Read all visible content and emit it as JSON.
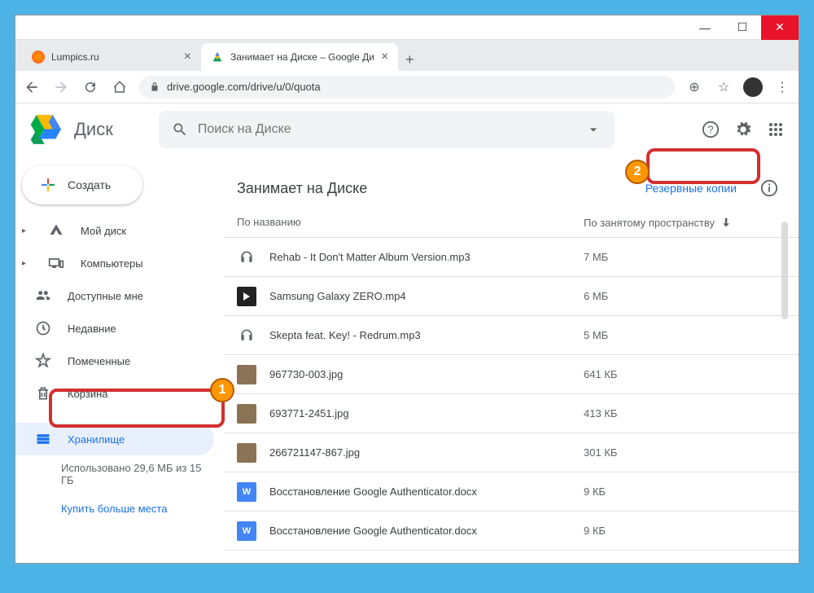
{
  "window": {
    "tabs": [
      {
        "title": "Lumpics.ru",
        "active": false
      },
      {
        "title": "Занимает на Диске – Google Ди",
        "active": true
      }
    ]
  },
  "addressbar": {
    "url": "drive.google.com/drive/u/0/quota"
  },
  "app": {
    "title": "Диск",
    "search_placeholder": "Поиск на Диске",
    "create_label": "Создать"
  },
  "sidebar": {
    "items": [
      {
        "label": "Мой диск",
        "icon": "drive"
      },
      {
        "label": "Компьютеры",
        "icon": "devices"
      },
      {
        "label": "Доступные мне",
        "icon": "shared"
      },
      {
        "label": "Недавние",
        "icon": "recent"
      },
      {
        "label": "Помеченные",
        "icon": "star"
      },
      {
        "label": "Корзина",
        "icon": "trash"
      }
    ],
    "storage_label": "Хранилище",
    "storage_info": "Использовано 29,6 МБ из 15 ГБ",
    "buy_more": "Купить больше места"
  },
  "main": {
    "title": "Занимает на Диске",
    "backups_label": "Резервные копии",
    "col_name": "По названию",
    "col_size": "По занятому пространству",
    "files": [
      {
        "name": "Rehab - It Don't Matter Album Version.mp3",
        "size": "7 МБ",
        "type": "audio"
      },
      {
        "name": "Samsung Galaxy ZERO.mp4",
        "size": "6 МБ",
        "type": "video"
      },
      {
        "name": "Skepta feat. Key! - Redrum.mp3",
        "size": "5 МБ",
        "type": "audio"
      },
      {
        "name": "967730-003.jpg",
        "size": "641 КБ",
        "type": "image"
      },
      {
        "name": "693771-2451.jpg",
        "size": "413 КБ",
        "type": "image"
      },
      {
        "name": "266721147-867.jpg",
        "size": "301 КБ",
        "type": "image"
      },
      {
        "name": "Восстановление Google Authenticator.docx",
        "size": "9 КБ",
        "type": "doc"
      },
      {
        "name": "Восстановление Google Authenticator.docx",
        "size": "9 КБ",
        "type": "doc"
      }
    ]
  },
  "callouts": {
    "one": "1",
    "two": "2"
  }
}
